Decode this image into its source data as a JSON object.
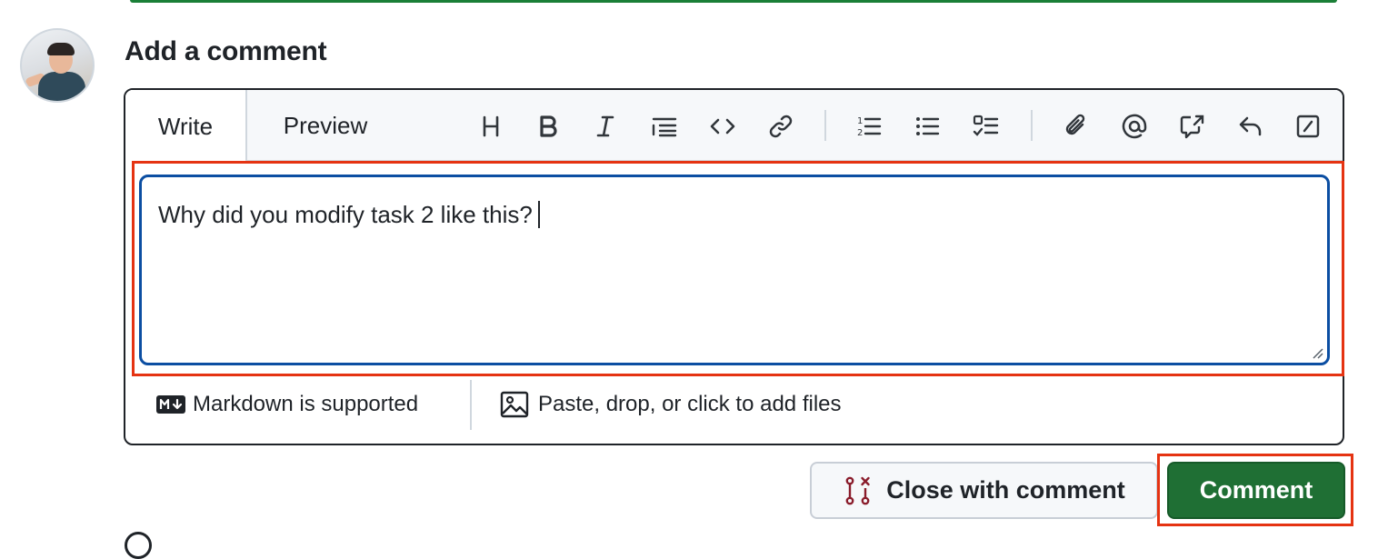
{
  "heading": "Add a comment",
  "tabs": {
    "write": "Write",
    "preview": "Preview"
  },
  "toolbar": {
    "icons": [
      "heading-icon",
      "bold-icon",
      "italic-icon",
      "quote-icon",
      "code-icon",
      "link-icon",
      "numbered-list-icon",
      "bulleted-list-icon",
      "task-list-icon",
      "attach-icon",
      "mention-icon",
      "cross-reference-icon",
      "reply-icon",
      "slash-command-icon"
    ]
  },
  "textarea": {
    "value": "Why did you modify task 2 like this?"
  },
  "footer": {
    "markdown_label": "Markdown is supported",
    "files_label": "Paste, drop, or click to add files"
  },
  "buttons": {
    "close_with_comment": "Close with comment",
    "comment": "Comment"
  },
  "colors": {
    "accent_green": "#1f6f34",
    "focus_blue": "#0b4ea2",
    "highlight_red": "#e53312",
    "close_icon_red": "#8a1c2b"
  }
}
